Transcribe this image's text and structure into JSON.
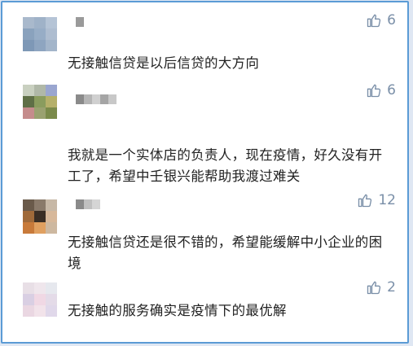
{
  "comments": [
    {
      "text": "无接触信贷是以后信贷的大方向",
      "likes": "6",
      "avatar_colors": [
        "#a9b9cc",
        "#9fb2c8",
        "#b5c4d6",
        "#8aa2bd",
        "#97adc6",
        "#aebdd0",
        "#7e98b6",
        "#8ea5c0",
        "#a3b5ca"
      ],
      "name_colors": [
        "#9a9a9a",
        "#ffffff"
      ]
    },
    {
      "text": "我就是一个实体店的负责人，现在疫情，好久没有开工了，希望中壬银兴能帮助我渡过难关",
      "likes": "6",
      "avatar_colors": [
        "#c9d0c0",
        "#b0b8a8",
        "#9aa6d0",
        "#5f6f46",
        "#8a9c5e",
        "#b5b06a",
        "#c58c8c",
        "#9aa170",
        "#7a8a4a"
      ],
      "name_colors": [
        "#8a8a8a",
        "#b5b5b5",
        "#d0d0d0",
        "#a5a5a5",
        "#c8c8c8"
      ]
    },
    {
      "text": "无接触信贷还是很不错的，希望能缓解中小企业的困境",
      "likes": "12",
      "avatar_colors": [
        "#6a5a4a",
        "#8a7a6a",
        "#c7b8a6",
        "#a06a3a",
        "#3a2e25",
        "#d7b89a",
        "#c87a3a",
        "#e0a060",
        "#cdb8a0"
      ],
      "name_colors": [
        "#8a8a8a",
        "#c0c0c0",
        "#d5d5d5"
      ]
    },
    {
      "text": "无接触的服务确实是疫情下的最优解",
      "likes": "2",
      "avatar_colors": [
        "#e8dfe6",
        "#efe6ec",
        "#e6e8ee",
        "#d9cfe3",
        "#f0d8e4",
        "#e4dbe8",
        "#ead7e2",
        "#f2e3ea",
        "#e0d8ea"
      ],
      "name_colors": []
    }
  ]
}
